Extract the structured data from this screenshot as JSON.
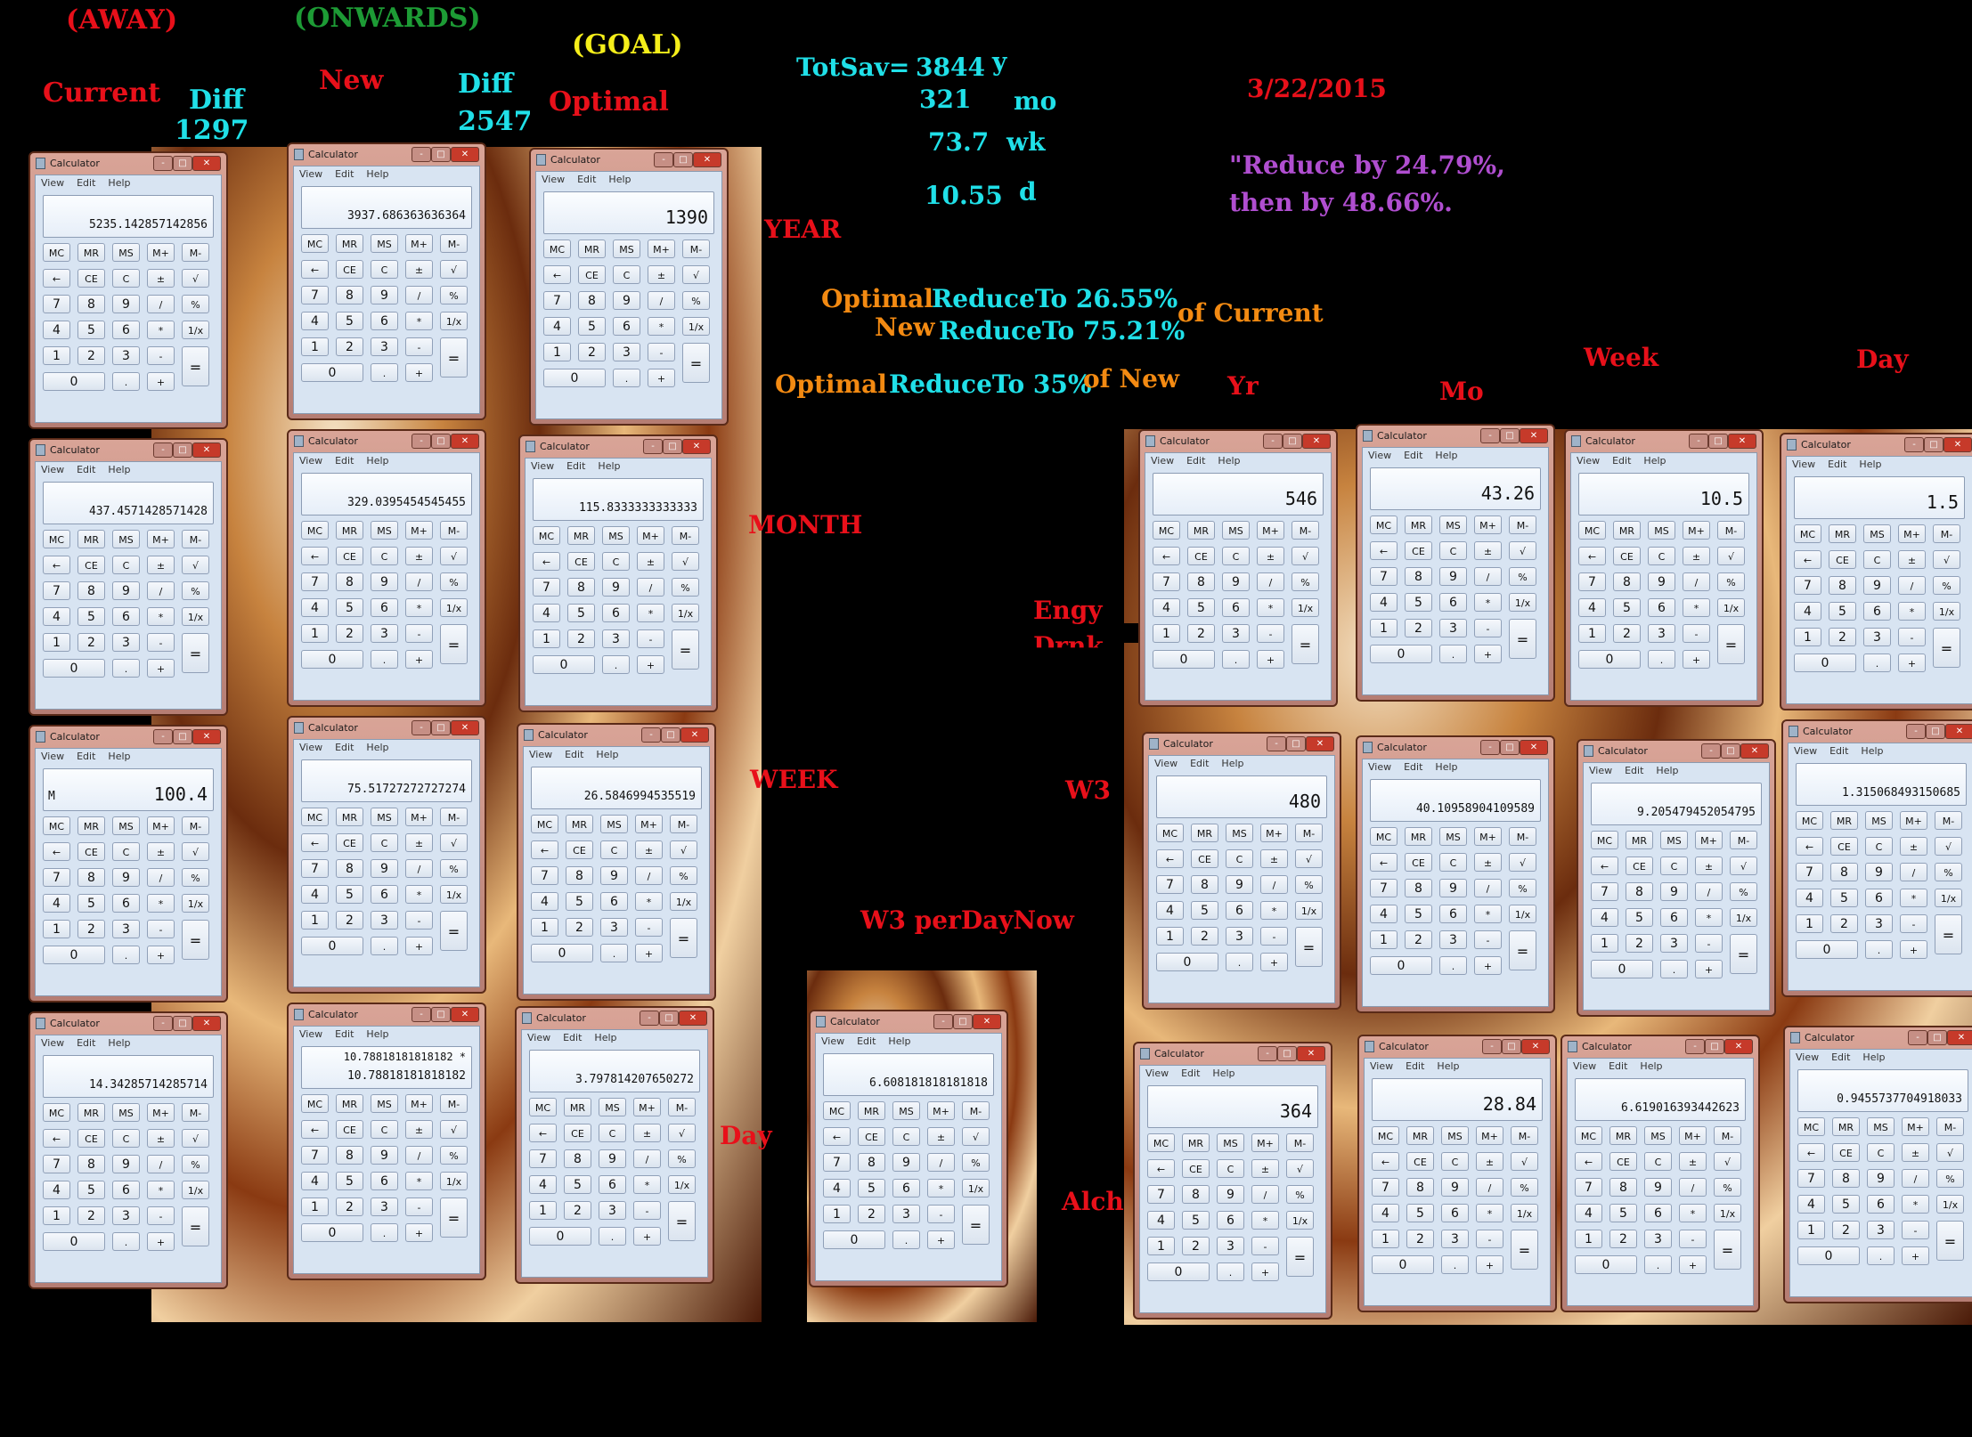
{
  "labels": {
    "away": "(AWAY)",
    "onwards": "(ONWARDS)",
    "goal": "(GOAL)",
    "current": "Current",
    "diff1": "Diff",
    "diff1_value": "1297",
    "new": "New",
    "diff2": "Diff",
    "diff2_value": "2547",
    "optimal": "Optimal",
    "totsav": "TotSav=",
    "totsav_y": "3844",
    "unit_y": "y",
    "totsav_mo": "321",
    "unit_mo": "mo",
    "totsav_wk": "73.7",
    "unit_wk": "wk",
    "totsav_d": "10.55",
    "unit_d": "d",
    "date": "3/22/2015",
    "reduce1": "\"Reduce by 24.79%,",
    "reduce2": "then by 48.66%.",
    "optimal_word_1": "Optimal",
    "reduce_current_a": "ReduceTo 26.55%",
    "new_word": "New",
    "reduce_current_b": "ReduceTo 75.21%",
    "of_current": "of Current",
    "optimal_word_2": "Optimal",
    "reduce_new": "ReduceTo 35%",
    "of_new": "of New",
    "row_year": "YEAR",
    "row_month": "MONTH",
    "row_week": "WEEK",
    "row_day": "Day",
    "col_yr": "Yr",
    "col_mo": "Mo",
    "col_week": "Week",
    "col_day": "Day",
    "engy": "Engy",
    "drnk": "Drnk",
    "w3": "W3",
    "alch": "Alch",
    "w3_per_day_now": "W3 perDayNow"
  },
  "calc": {
    "title": "Calculator",
    "menu": [
      "View",
      "Edit",
      "Help"
    ],
    "window_buttons": [
      "-",
      "□",
      "✕"
    ],
    "key_rows": [
      [
        "MC",
        "MR",
        "MS",
        "M+",
        "M-"
      ],
      [
        "←",
        "CE",
        "C",
        "±",
        "√"
      ],
      [
        "7",
        "8",
        "9",
        "/",
        "%"
      ],
      [
        "4",
        "5",
        "6",
        "*",
        "1/x"
      ],
      [
        "1",
        "2",
        "3",
        "-",
        "="
      ],
      [
        "0",
        ".",
        "+"
      ]
    ]
  },
  "calculators": [
    {
      "id": "current-year",
      "display": "5235.142857142856"
    },
    {
      "id": "current-month",
      "display": "437.4571428571428"
    },
    {
      "id": "current-week",
      "display": "100.4",
      "memory": "M"
    },
    {
      "id": "current-day",
      "display": "14.34285714285714"
    },
    {
      "id": "new-year",
      "display": "3937.686363636364"
    },
    {
      "id": "new-month",
      "display": "329.0395454545455"
    },
    {
      "id": "new-week",
      "display": "75.51727272727274"
    },
    {
      "id": "new-day",
      "display": "10.78818181818182",
      "history": "10.78818181818182 *"
    },
    {
      "id": "optimal-year",
      "display": "1390"
    },
    {
      "id": "optimal-month",
      "display": "115.8333333333333"
    },
    {
      "id": "optimal-week",
      "display": "26.5846994535519"
    },
    {
      "id": "optimal-day",
      "display": "3.797814207650272"
    },
    {
      "id": "w3-per-day-now",
      "display": "6.608181818181818"
    },
    {
      "id": "engy-yr",
      "display": "546"
    },
    {
      "id": "engy-mo",
      "display": "43.26"
    },
    {
      "id": "engy-week",
      "display": "10.5"
    },
    {
      "id": "engy-day",
      "display": "1.5"
    },
    {
      "id": "w3-yr",
      "display": "480"
    },
    {
      "id": "w3-mo",
      "display": "40.10958904109589"
    },
    {
      "id": "w3-week",
      "display": "9.205479452054795"
    },
    {
      "id": "w3-day",
      "display": "1.315068493150685"
    },
    {
      "id": "alch-yr",
      "display": "364"
    },
    {
      "id": "alch-mo",
      "display": "28.84"
    },
    {
      "id": "alch-week",
      "display": "6.619016393442623"
    },
    {
      "id": "alch-day",
      "display": "0.9455737704918033"
    }
  ]
}
